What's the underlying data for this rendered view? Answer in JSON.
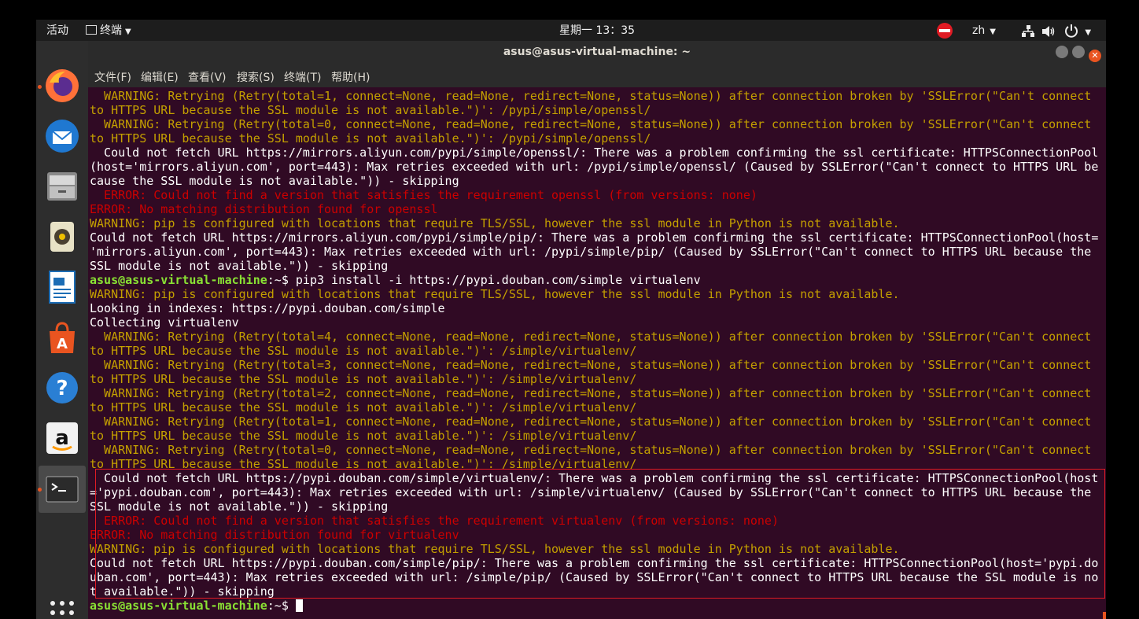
{
  "topbar": {
    "activities": "活动",
    "app_menu": "终端",
    "clock": "星期一 13：35",
    "lang": "zh"
  },
  "window": {
    "title": "asus@asus-virtual-machine: ~",
    "menu": [
      "文件(F)",
      "编辑(E)",
      "查看(V)",
      "搜索(S)",
      "终端(T)",
      "帮助(H)"
    ]
  },
  "dock": [
    {
      "name": "firefox",
      "running": true
    },
    {
      "name": "thunderbird",
      "running": false
    },
    {
      "name": "files",
      "running": false
    },
    {
      "name": "rhythmbox",
      "running": false
    },
    {
      "name": "libreoffice-writer",
      "running": false
    },
    {
      "name": "ubuntu-software",
      "running": false
    },
    {
      "name": "help",
      "running": false
    },
    {
      "name": "amazon",
      "running": false
    },
    {
      "name": "terminal",
      "running": true
    },
    {
      "name": "show-applications",
      "running": false
    }
  ],
  "terminal": {
    "prompt_user": "asus@asus-virtual-machine",
    "prompt_suffix": ":~$ ",
    "lines": [
      {
        "t": "w",
        "s": "  WARNING: Retrying (Retry(total=1, connect=None, read=None, redirect=None, status=None)) after connection broken by 'SSLError(\"Can't connect"
      },
      {
        "t": "w",
        "s": "to HTTPS URL because the SSL module is not available.\")': /pypi/simple/openssl/"
      },
      {
        "t": "w",
        "s": "  WARNING: Retrying (Retry(total=0, connect=None, read=None, redirect=None, status=None)) after connection broken by 'SSLError(\"Can't connect"
      },
      {
        "t": "w",
        "s": "to HTTPS URL because the SSL module is not available.\")': /pypi/simple/openssl/"
      },
      {
        "t": "n",
        "s": "  Could not fetch URL https://mirrors.aliyun.com/pypi/simple/openssl/: There was a problem confirming the ssl certificate: HTTPSConnectionPool"
      },
      {
        "t": "n",
        "s": "(host='mirrors.aliyun.com', port=443): Max retries exceeded with url: /pypi/simple/openssl/ (Caused by SSLError(\"Can't connect to HTTPS URL be"
      },
      {
        "t": "n",
        "s": "cause the SSL module is not available.\")) - skipping"
      },
      {
        "t": "e",
        "s": "  ERROR: Could not find a version that satisfies the requirement openssl (from versions: none)"
      },
      {
        "t": "e",
        "s": "ERROR: No matching distribution found for openssl"
      },
      {
        "t": "w",
        "s": "WARNING: pip is configured with locations that require TLS/SSL, however the ssl module in Python is not available."
      },
      {
        "t": "n",
        "s": "Could not fetch URL https://mirrors.aliyun.com/pypi/simple/pip/: There was a problem confirming the ssl certificate: HTTPSConnectionPool(host="
      },
      {
        "t": "n",
        "s": "'mirrors.aliyun.com', port=443): Max retries exceeded with url: /pypi/simple/pip/ (Caused by SSLError(\"Can't connect to HTTPS URL because the"
      },
      {
        "t": "n",
        "s": "SSL module is not available.\")) - skipping"
      },
      {
        "t": "p",
        "s": "pip3 install -i https://pypi.douban.com/simple virtualenv"
      },
      {
        "t": "w",
        "s": "WARNING: pip is configured with locations that require TLS/SSL, however the ssl module in Python is not available."
      },
      {
        "t": "n",
        "s": "Looking in indexes: https://pypi.douban.com/simple"
      },
      {
        "t": "n",
        "s": "Collecting virtualenv"
      },
      {
        "t": "w",
        "s": "  WARNING: Retrying (Retry(total=4, connect=None, read=None, redirect=None, status=None)) after connection broken by 'SSLError(\"Can't connect"
      },
      {
        "t": "w",
        "s": "to HTTPS URL because the SSL module is not available.\")': /simple/virtualenv/"
      },
      {
        "t": "w",
        "s": "  WARNING: Retrying (Retry(total=3, connect=None, read=None, redirect=None, status=None)) after connection broken by 'SSLError(\"Can't connect"
      },
      {
        "t": "w",
        "s": "to HTTPS URL because the SSL module is not available.\")': /simple/virtualenv/"
      },
      {
        "t": "w",
        "s": "  WARNING: Retrying (Retry(total=2, connect=None, read=None, redirect=None, status=None)) after connection broken by 'SSLError(\"Can't connect"
      },
      {
        "t": "w",
        "s": "to HTTPS URL because the SSL module is not available.\")': /simple/virtualenv/"
      },
      {
        "t": "w",
        "s": "  WARNING: Retrying (Retry(total=1, connect=None, read=None, redirect=None, status=None)) after connection broken by 'SSLError(\"Can't connect"
      },
      {
        "t": "w",
        "s": "to HTTPS URL because the SSL module is not available.\")': /simple/virtualenv/"
      },
      {
        "t": "w",
        "s": "  WARNING: Retrying (Retry(total=0, connect=None, read=None, redirect=None, status=None)) after connection broken by 'SSLError(\"Can't connect"
      },
      {
        "t": "w",
        "s": "to HTTPS URL because the SSL module is not available.\")': /simple/virtualenv/"
      },
      {
        "t": "n",
        "s": "  Could not fetch URL https://pypi.douban.com/simple/virtualenv/: There was a problem confirming the ssl certificate: HTTPSConnectionPool(host"
      },
      {
        "t": "n",
        "s": "='pypi.douban.com', port=443): Max retries exceeded with url: /simple/virtualenv/ (Caused by SSLError(\"Can't connect to HTTPS URL because the"
      },
      {
        "t": "n",
        "s": "SSL module is not available.\")) - skipping"
      },
      {
        "t": "e",
        "s": "  ERROR: Could not find a version that satisfies the requirement virtualenv (from versions: none)"
      },
      {
        "t": "e",
        "s": "ERROR: No matching distribution found for virtualenv"
      },
      {
        "t": "w",
        "s": "WARNING: pip is configured with locations that require TLS/SSL, however the ssl module in Python is not available."
      },
      {
        "t": "n",
        "s": "Could not fetch URL https://pypi.douban.com/simple/pip/: There was a problem confirming the ssl certificate: HTTPSConnectionPool(host='pypi.do"
      },
      {
        "t": "n",
        "s": "uban.com', port=443): Max retries exceeded with url: /simple/pip/ (Caused by SSLError(\"Can't connect to HTTPS URL because the SSL module is no"
      },
      {
        "t": "n",
        "s": "t available.\")) - skipping"
      },
      {
        "t": "p",
        "s": ""
      }
    ]
  }
}
